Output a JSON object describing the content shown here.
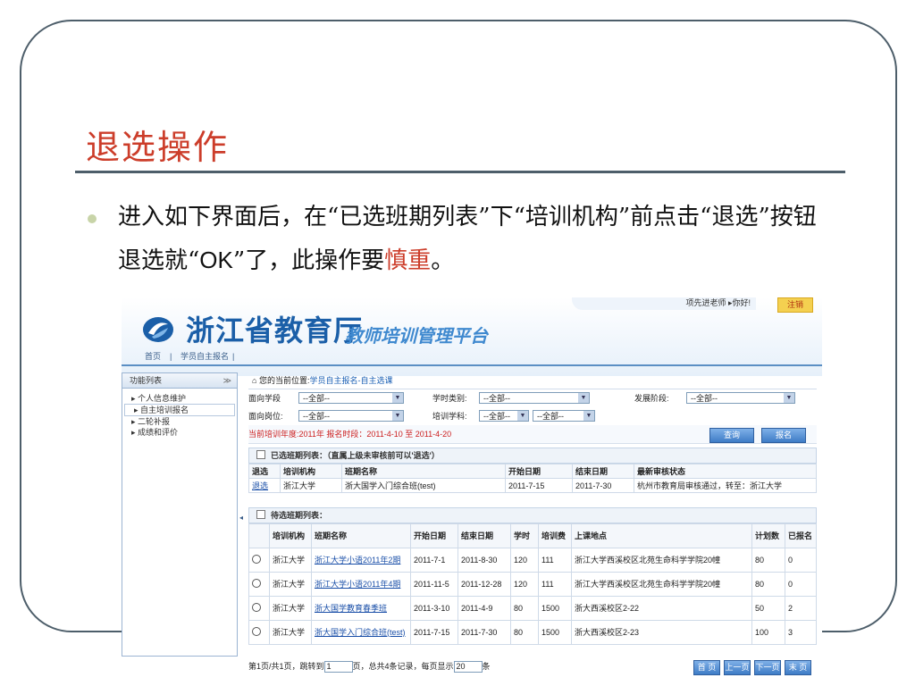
{
  "slide": {
    "title": "退选操作",
    "bullet": {
      "pre": "进入如下界面后，在“已选班期列表”下“培训机构”前点击“退选”按钮退选就“",
      "ok": "OK",
      "mid": "”了，此操作要",
      "highlight": "慎重",
      "post": "。"
    }
  },
  "app": {
    "logo": {
      "main": "浙江省教育厅",
      "sub": "教师培训管理平台"
    },
    "user": {
      "greeting": "项先进老师 ▸你好!",
      "logout": "注销"
    },
    "nav": [
      "首页",
      "|",
      "学员自主报名",
      "|"
    ],
    "sidebar": {
      "title": "功能列表",
      "toggle": "≫",
      "items": [
        "▸ 个人信息维护",
        "▸ 自主培训报名",
        "▸ 二轮补报",
        "▸ 成绩和评价"
      ]
    },
    "crumb": {
      "icon": "⌂",
      "prefix": "您的当前位置:",
      "path": "学员自主报名-自主选课"
    },
    "filters": {
      "row1": [
        {
          "label": "面向学段",
          "value": "--全部--"
        },
        {
          "label": "学时类别:",
          "value": "--全部--"
        },
        {
          "label": "发展阶段:",
          "value": "--全部--"
        }
      ],
      "row2": [
        {
          "label": "面向岗位:",
          "value": "--全部--"
        },
        {
          "label": "培训学科:",
          "value": "--全部--",
          "value2": "--全部--"
        }
      ]
    },
    "info": {
      "text": "当前培训年度:2011年   报名时段：2011-4-10 至 2011-4-20",
      "query": "查询",
      "enroll": "报名"
    },
    "selected": {
      "title": "已选班期列表：（直属上级未审核前可以'退选'）",
      "headers": [
        "退选",
        "培训机构",
        "班期名称",
        "开始日期",
        "结束日期",
        "最新审核状态"
      ],
      "rows": [
        [
          "退选",
          "浙江大学",
          "浙大国学入门综合班(test)",
          "2011-7-15",
          "2011-7-30",
          "杭州市教育局审核通过，转至：浙江大学"
        ]
      ]
    },
    "pending": {
      "title": "待选班期列表：",
      "headers": [
        "",
        "培训机构",
        "班期名称",
        "开始日期",
        "结束日期",
        "学时",
        "培训费",
        "上课地点",
        "计划数",
        "已报名"
      ],
      "rows": [
        [
          "",
          "浙江大学",
          "浙江大学小语2011年2期",
          "2011-7-1",
          "2011-8-30",
          "120",
          "111",
          "浙江大学西溪校区北苑生命科学学院20幢",
          "80",
          "0"
        ],
        [
          "",
          "浙江大学",
          "浙江大学小语2011年4期",
          "2011-11-5",
          "2011-12-28",
          "120",
          "111",
          "浙江大学西溪校区北苑生命科学学院20幢",
          "80",
          "0"
        ],
        [
          "",
          "浙江大学",
          "浙大国学教育春季班",
          "2011-3-10",
          "2011-4-9",
          "80",
          "1500",
          "浙大西溪校区2-22",
          "50",
          "2"
        ],
        [
          "",
          "浙江大学",
          "浙大国学入门综合班(test)",
          "2011-7-15",
          "2011-7-30",
          "80",
          "1500",
          "浙大西溪校区2-23",
          "100",
          "3"
        ]
      ]
    },
    "pager": {
      "pre": "第1页/共1页，跳转到",
      "page": "1",
      "mid": "页，总共4条记录，每页显示",
      "size": "20",
      "post": "条",
      "buttons": [
        "首 页",
        "上一页",
        "下一页",
        "末 页"
      ]
    }
  }
}
